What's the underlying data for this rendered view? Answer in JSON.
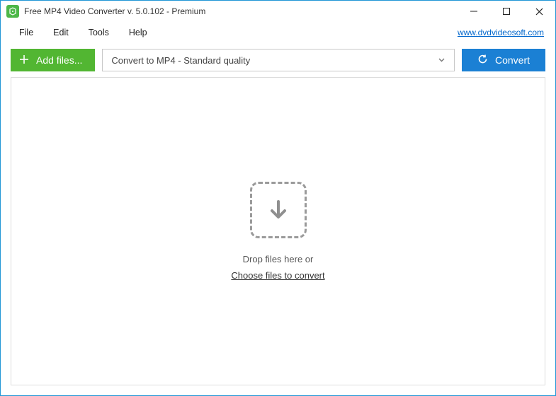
{
  "titlebar": {
    "title": "Free MP4 Video Converter v. 5.0.102 - Premium"
  },
  "menubar": {
    "items": [
      "File",
      "Edit",
      "Tools",
      "Help"
    ],
    "link": "www.dvdvideosoft.com"
  },
  "toolbar": {
    "add_label": "Add files...",
    "preset_label": "Convert to MP4 - Standard quality",
    "convert_label": "Convert"
  },
  "dropzone": {
    "drop_text": "Drop files here or",
    "choose_text": "Choose files to convert"
  }
}
